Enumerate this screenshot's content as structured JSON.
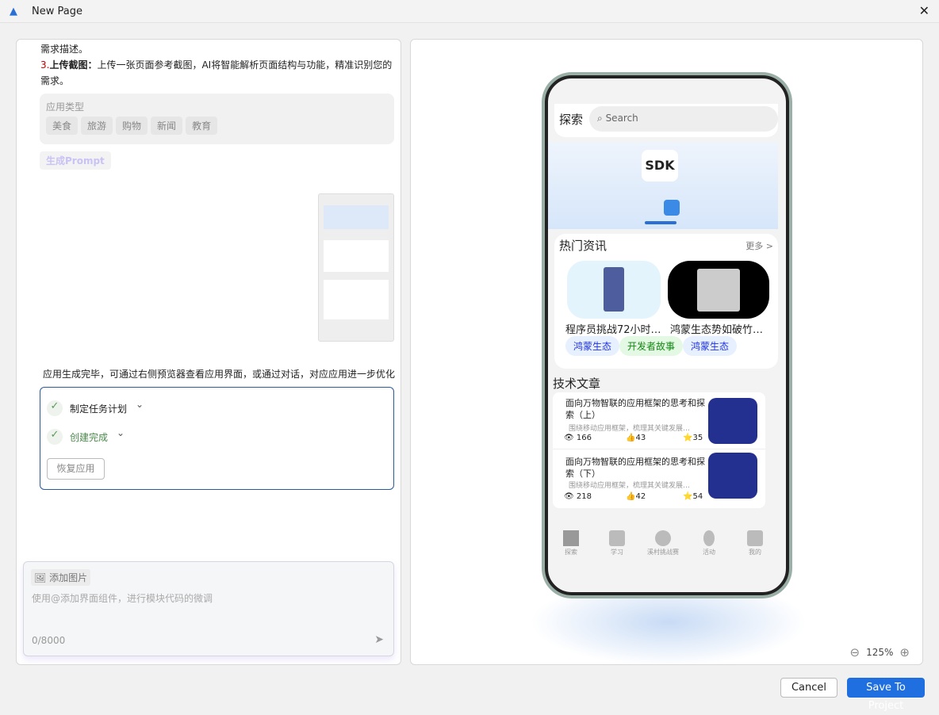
{
  "window": {
    "title": "New Page",
    "close_icon": "close-icon"
  },
  "chat": {
    "line1": "需求描述。",
    "line2_num": "3.",
    "line2_bold": "上传截图：",
    "line2_rest": "上传一张页面参考截图，AI将智能解析页面结构与功能，精准识别您的需求。",
    "app_type_label": "应用类型",
    "app_types": [
      "美食",
      "旅游",
      "购物",
      "新闻",
      "教育"
    ],
    "generate_prompt": "生成Prompt",
    "done_message": "应用生成完毕，可通过右侧预览器查看应用界面，或通过对话，对应应用进一步优化",
    "steps": [
      {
        "label": "制定任务计划"
      },
      {
        "label": "创建完成"
      }
    ],
    "restore_button": "恢复应用",
    "add_image": "添加图片",
    "input_placeholder": "使用@添加界面组件，进行模块代码的微调",
    "char_count": "0/8000"
  },
  "preview": {
    "zoom": "125%",
    "app": {
      "title": "探索",
      "search_placeholder": "Search",
      "hot_title": "热门资讯",
      "more": "更多 >",
      "news": [
        {
          "title": "程序员挑战72小时…"
        },
        {
          "title": "鸿蒙生态势如破竹…"
        }
      ],
      "tags": [
        "鸿蒙生态",
        "开发者故事",
        "鸿蒙生态"
      ],
      "tech_title": "技术文章",
      "articles": [
        {
          "title": "面向万物智联的应用框架的思考和探索（上）",
          "desc": "围绕移动应用框架，梳理其关键发展…",
          "views": "166",
          "likes": "43",
          "stars": "35"
        },
        {
          "title": "面向万物智联的应用框架的思考和探索（下）",
          "desc": "围绕移动应用框架，梳理其关键发展…",
          "views": "218",
          "likes": "42",
          "stars": "54"
        }
      ],
      "nav": [
        "探索",
        "学习",
        "溪村挑战赛",
        "活动",
        "我的"
      ]
    }
  },
  "footer": {
    "cancel": "Cancel",
    "save": "Save To Project"
  },
  "colors": {
    "accent": "#1f6fe0",
    "tag_blue_bg": "#e6f0ff",
    "tag_green_bg": "#e3f9e3"
  }
}
